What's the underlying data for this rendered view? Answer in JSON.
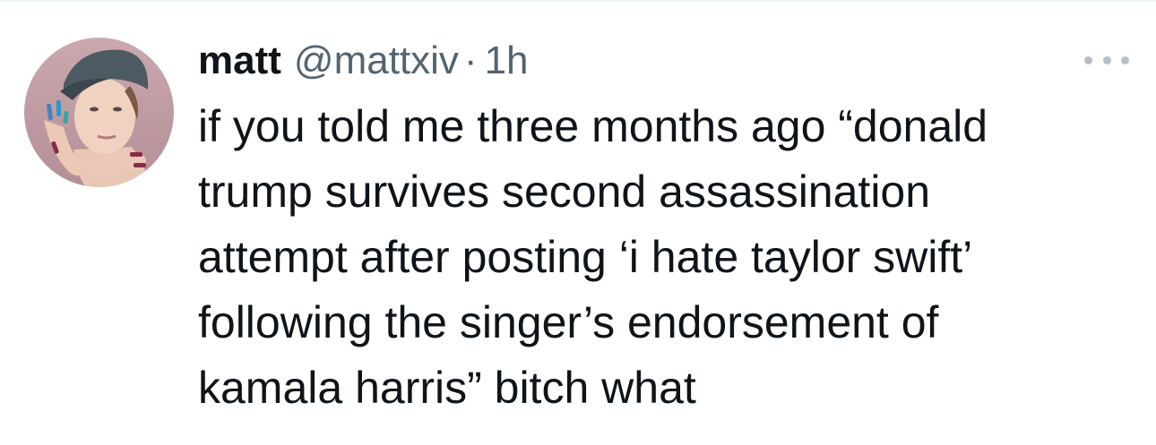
{
  "tweet": {
    "author": {
      "name": "matt",
      "handle": "@mattxiv",
      "separator": "·",
      "time": "1h",
      "avatar_icon": "profile-photo"
    },
    "more_icon": "more-options-icon",
    "text_lines": [
      "if you told me three months ago “donald",
      "trump survives second assassination",
      "attempt after posting ‘i hate taylor swift’",
      "following the singer’s endorsement of",
      "kamala harris” bitch what"
    ]
  }
}
